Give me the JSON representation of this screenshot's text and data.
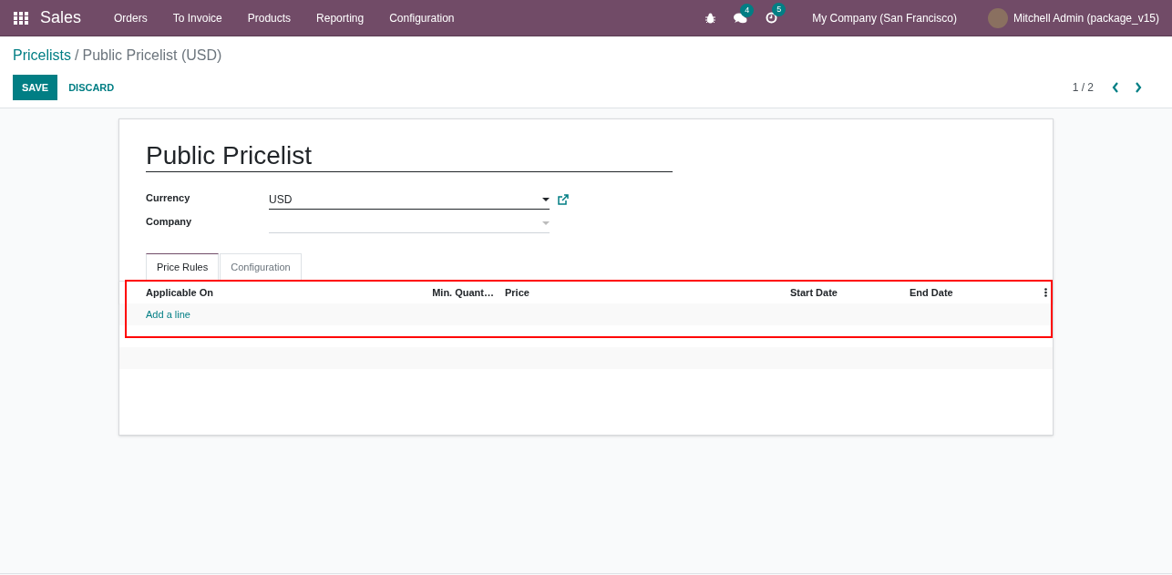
{
  "navbar": {
    "app_name": "Sales",
    "menu": [
      "Orders",
      "To Invoice",
      "Products",
      "Reporting",
      "Configuration"
    ],
    "systray": [
      {
        "kind": "debug"
      },
      {
        "kind": "messages",
        "badge": "4"
      },
      {
        "kind": "activities",
        "badge": "5"
      }
    ],
    "company": "My Company (San Francisco)",
    "user": "Mitchell Admin (package_v15)"
  },
  "breadcrumb": {
    "parent": "Pricelists",
    "separator": "/",
    "current": "Public Pricelist (USD)"
  },
  "buttons": [
    {
      "label": "SAVE",
      "kind": "primary"
    },
    {
      "label": "DISCARD",
      "kind": "link"
    }
  ],
  "pager": "1 / 2",
  "form": {
    "title": "Public Pricelist",
    "fields": [
      {
        "label": "Currency",
        "value": "USD",
        "external_link": true
      },
      {
        "label": "Company",
        "external_link": false
      }
    ],
    "tabs": [
      {
        "label": "Price Rules",
        "selected": true
      },
      {
        "label": "Configuration",
        "selected": false
      }
    ],
    "table": {
      "columns": [
        "Applicable On",
        "Min. Quant…",
        "Price",
        "Start Date",
        "End Date"
      ],
      "add_line": "Add a line",
      "highlighted": true
    }
  }
}
